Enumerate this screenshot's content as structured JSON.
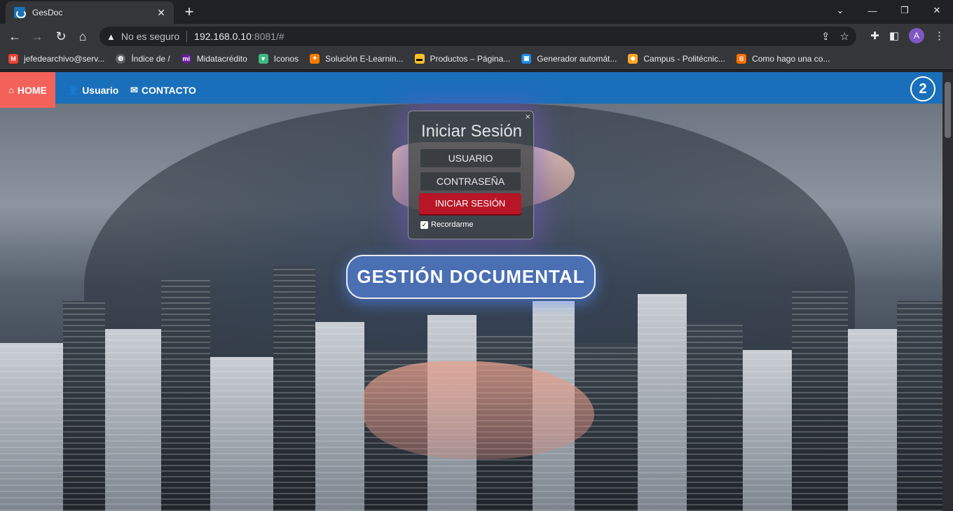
{
  "browser": {
    "tab_title": "GesDoc",
    "tab_close": "✕",
    "new_tab": "+",
    "security_label": "No es seguro",
    "url_host": "192.168.0.10",
    "url_rest": ":8081/#",
    "profile_initial": "A"
  },
  "bookmarks": [
    {
      "label": "jefedearchivo@serv...",
      "icon": "gmail-icon",
      "color": "#ea4335"
    },
    {
      "label": "Índice de /",
      "icon": "globe-icon",
      "color": "#5f6368"
    },
    {
      "label": "Midatacrédito",
      "icon": "midatacredito-icon",
      "color": "#6a1b9a"
    },
    {
      "label": "Iconos",
      "icon": "vue-icon",
      "color": "#41b883"
    },
    {
      "label": "Solución E-Learnin...",
      "icon": "elearning-icon",
      "color": "#f57c00"
    },
    {
      "label": "Productos – Página...",
      "icon": "productos-icon",
      "color": "#fbc02d"
    },
    {
      "label": "Generador automát...",
      "icon": "generador-icon",
      "color": "#1e88e5"
    },
    {
      "label": "Campus - Politécnic...",
      "icon": "campus-icon",
      "color": "#f9a825"
    },
    {
      "label": "Como hago una co...",
      "icon": "blogger-icon",
      "color": "#ff6f00"
    }
  ],
  "navbar": {
    "home": "HOME",
    "usuario": "Usuario",
    "contacto": "CONTACTO",
    "color": "#1a6fba",
    "active_color": "#f2625a"
  },
  "login": {
    "close": "×",
    "title": "Iniciar Sesión",
    "user_placeholder": "USUARIO",
    "password_placeholder": "CONTRASEÑA",
    "submit": "INICIAR SESIÓN",
    "remember": "Recordarme",
    "remember_checked": true
  },
  "banner": {
    "text": "GESTIÓN DOCUMENTAL"
  }
}
